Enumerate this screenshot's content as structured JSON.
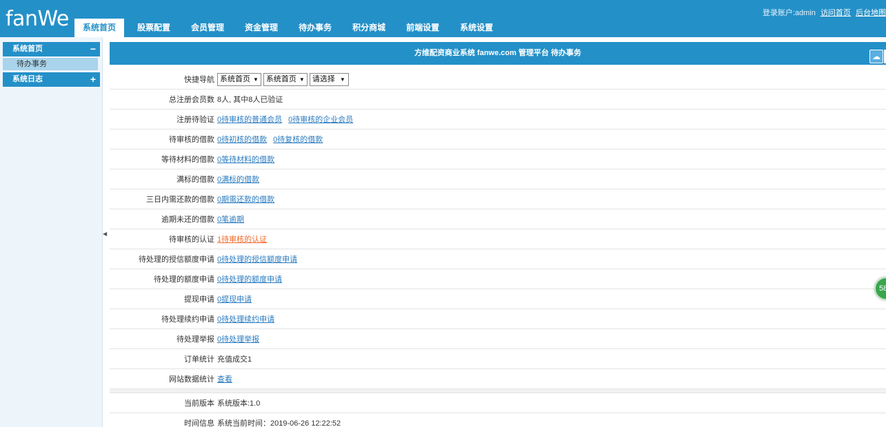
{
  "header": {
    "logo": "fanWe",
    "account_label": "登录账户:admin",
    "visit_home": "访问首页",
    "admin_map": "后台地图"
  },
  "nav": [
    {
      "label": "系统首页"
    },
    {
      "label": "股票配置"
    },
    {
      "label": "会员管理"
    },
    {
      "label": "资金管理"
    },
    {
      "label": "待办事务"
    },
    {
      "label": "积分商城"
    },
    {
      "label": "前端设置"
    },
    {
      "label": "系统设置"
    }
  ],
  "sidebar": {
    "group1": {
      "label": "系统首页",
      "toggle": "−"
    },
    "item1": "待办事务",
    "group2": {
      "label": "系统日志",
      "toggle": "+"
    }
  },
  "main": {
    "title": "方维配资商业系统 fanwe.com 管理平台 待办事务"
  },
  "quick_nav": {
    "label": "快捷导航",
    "select1": "系统首页",
    "select2": "系统首页",
    "select3": "请选择"
  },
  "rows": {
    "members": {
      "label": "总注册会员数",
      "value": "8人, 其中8人已验证"
    },
    "reg_verify": {
      "label": "注册待验证",
      "link1": "0待审核的普通会员",
      "link2": "0待审核的企业会员"
    },
    "loan_review": {
      "label": "待审核的借款",
      "link1": "0待初核的借款",
      "link2": "0待复核的借款"
    },
    "loan_material": {
      "label": "等待材料的借款",
      "link1": "0等待材料的借款"
    },
    "loan_full": {
      "label": "满标的借款",
      "link1": "0满标的借款"
    },
    "repay_3days": {
      "label": "三日内需还款的借款",
      "link1": "0期需还款的借款"
    },
    "overdue": {
      "label": "逾期未还的借款",
      "link1": "0笔逾期"
    },
    "cert": {
      "label": "待审核的认证",
      "link1": "1待审核的认证"
    },
    "credit": {
      "label": "待处理的授信额度申请",
      "link1": "0待处理的授信额度申请"
    },
    "quota": {
      "label": "待处理的额度申请",
      "link1": "0待处理的额度申请"
    },
    "withdraw": {
      "label": "提现申请",
      "link1": "0提现申请"
    },
    "renew": {
      "label": "待处理续约申请",
      "link1": "0待处理续约申请"
    },
    "report": {
      "label": "待处理举报",
      "link1": "0待处理举报"
    },
    "orders": {
      "label": "订单统计",
      "value": "充值成交1"
    },
    "site_stats": {
      "label": "网站数据统计",
      "link1": "查看"
    },
    "version": {
      "label": "当前版本",
      "value": "系统版本:1.0"
    },
    "time": {
      "label": "时间信息",
      "value": "系统当前时间：2019-06-26 12:22:52"
    }
  },
  "float_badge": "58"
}
